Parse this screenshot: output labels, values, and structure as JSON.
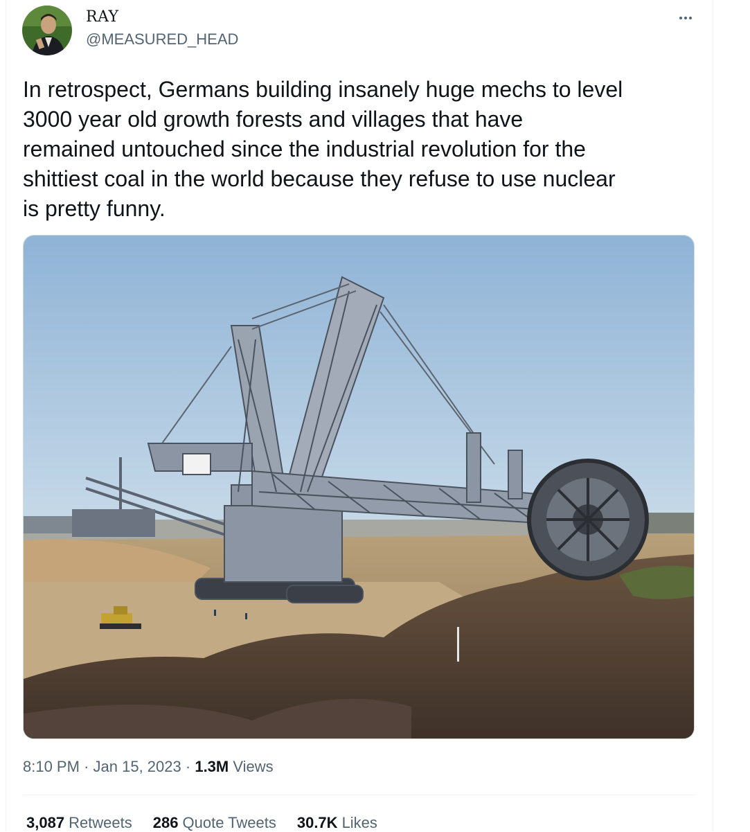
{
  "author": {
    "name": "RAY",
    "handle": "@MEASURED_HEAD"
  },
  "tweet": {
    "text": "In retrospect, Germans building insanely huge mechs to level\n3000 year old growth forests and villages that have\nremained untouched since the industrial revolution for the\nshittiest coal in the world because they refuse to use nuclear\nis pretty funny.",
    "time": "8:10 PM",
    "separator": "·",
    "date": "Jan 15, 2023",
    "views_count": "1.3M",
    "views_label": "Views"
  },
  "stats": {
    "retweets_count": "3,087",
    "retweets_label": "Retweets",
    "quotes_count": "286",
    "quotes_label": "Quote Tweets",
    "likes_count": "30.7K",
    "likes_label": "Likes"
  },
  "media": {
    "icon": "bucket-wheel-excavator-photo"
  },
  "colors": {
    "text": "#0f1419",
    "secondary": "#536471",
    "border": "#cfd9de"
  }
}
